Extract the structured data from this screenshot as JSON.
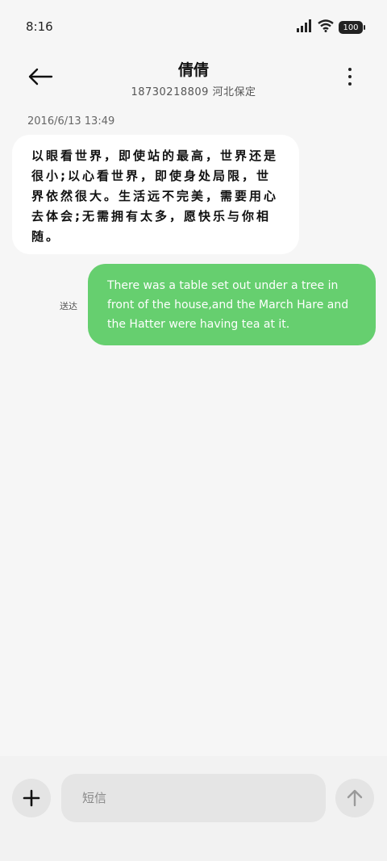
{
  "status_bar": {
    "time": "8:16",
    "battery": "100"
  },
  "header": {
    "contact_name": "倩倩",
    "contact_sub": "18730218809 河北保定"
  },
  "conversation": {
    "timestamp": "2016/6/13 13:49",
    "received_message": "以眼看世界，即使站的最高，世界还是很小;以心看世界，即使身处局限，世界依然很大。生活远不完美，需要用心去体会;无需拥有太多，愿快乐与你相随。",
    "sent_status": "送达",
    "sent_message": "There was a table set out under a tree in front of the house,and the March Hare and the Hatter were having tea at it."
  },
  "composer": {
    "placeholder": "短信"
  },
  "colors": {
    "sent_bubble": "#66cf6f",
    "background": "#f6f6f6"
  }
}
